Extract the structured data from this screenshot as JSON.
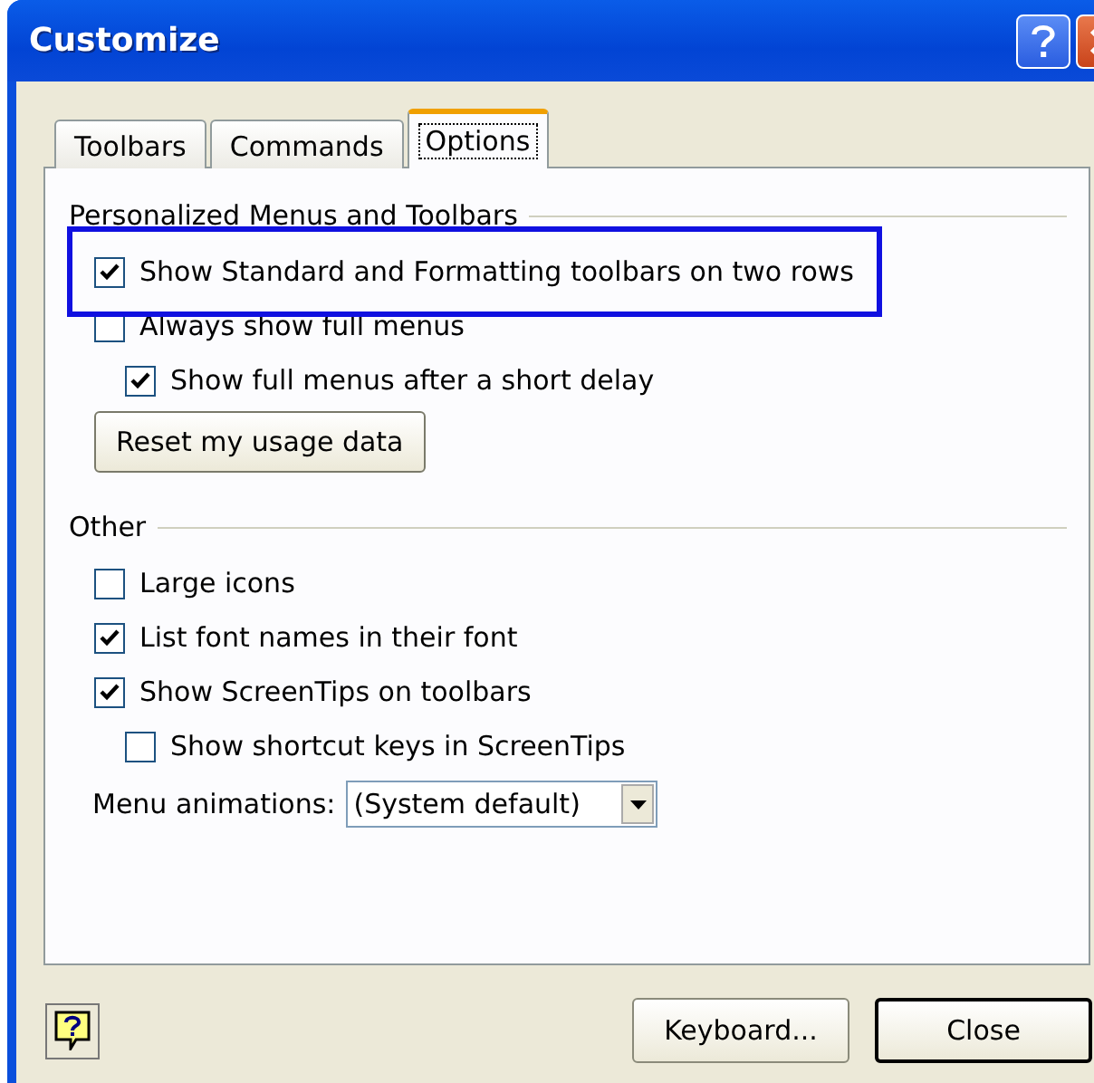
{
  "window": {
    "title": "Customize"
  },
  "tabs": [
    {
      "label": "Toolbars",
      "selected": false
    },
    {
      "label": "Commands",
      "selected": false
    },
    {
      "label": "Options",
      "selected": true
    }
  ],
  "groups": [
    {
      "title": "Personalized Menus and Toolbars",
      "items": [
        {
          "kind": "checkbox",
          "label": "Show Standard and Formatting toolbars on two rows",
          "checked": true,
          "highlighted": true
        },
        {
          "kind": "checkbox",
          "label": "Always show full menus",
          "checked": false,
          "highlighted": false,
          "children": [
            {
              "kind": "checkbox",
              "label": "Show full menus after a short delay",
              "checked": true,
              "highlighted": false
            }
          ]
        },
        {
          "kind": "button",
          "label": "Reset my usage data",
          "highlighted": false
        }
      ]
    },
    {
      "title": "Other",
      "items": [
        {
          "kind": "checkbox",
          "label": "Large icons",
          "checked": false,
          "highlighted": false
        },
        {
          "kind": "checkbox",
          "label": "List font names in their font",
          "checked": true,
          "highlighted": false
        },
        {
          "kind": "checkbox",
          "label": "Show ScreenTips on toolbars",
          "checked": true,
          "highlighted": false,
          "children": [
            {
              "kind": "checkbox",
              "label": "Show shortcut keys in ScreenTips",
              "checked": false,
              "highlighted": false
            }
          ]
        },
        {
          "kind": "dropdown",
          "label": "Menu animations:",
          "value": "(System default)",
          "highlighted": false
        }
      ]
    }
  ],
  "buttons": [
    {
      "label": "Keyboard...",
      "default": false
    },
    {
      "label": "Close",
      "default": true
    }
  ]
}
